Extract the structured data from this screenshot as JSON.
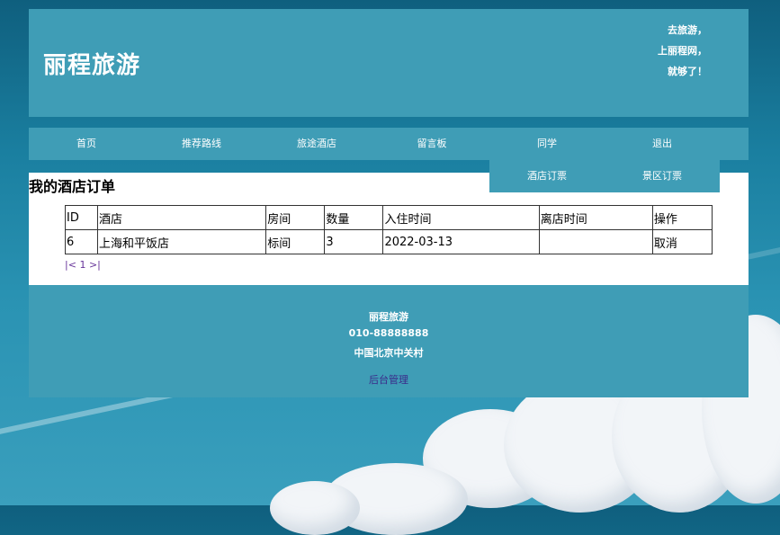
{
  "header": {
    "logo": "丽程旅游",
    "slogan": [
      "去旅游，",
      "上丽程网，",
      "就够了！"
    ]
  },
  "nav": {
    "items": [
      {
        "label": "首页"
      },
      {
        "label": "推荐路线"
      },
      {
        "label": "旅途酒店"
      },
      {
        "label": "留言板"
      },
      {
        "label": "同学"
      },
      {
        "label": "退出"
      }
    ],
    "submenu": [
      {
        "label": "酒店订票"
      },
      {
        "label": "景区订票"
      }
    ]
  },
  "main": {
    "title": "我的酒店订单",
    "table": {
      "headers": [
        "ID",
        "酒店",
        "房间",
        "数量",
        "入住时间",
        "离店时间",
        "操作"
      ],
      "rows": [
        [
          "6",
          "上海和平饭店",
          "标间",
          "3",
          "2022-03-13",
          "",
          "取消"
        ]
      ]
    },
    "pager": {
      "prev": "|<",
      "page": "1",
      "next": ">|"
    }
  },
  "footer": {
    "name": "丽程旅游",
    "phone": "010-88888888",
    "address": "中国北京中关村",
    "admin_link": "后台管理"
  },
  "colors": {
    "panel": "#3f9db6",
    "link_visited": "#663399",
    "admin_link": "#3b2a8a"
  }
}
